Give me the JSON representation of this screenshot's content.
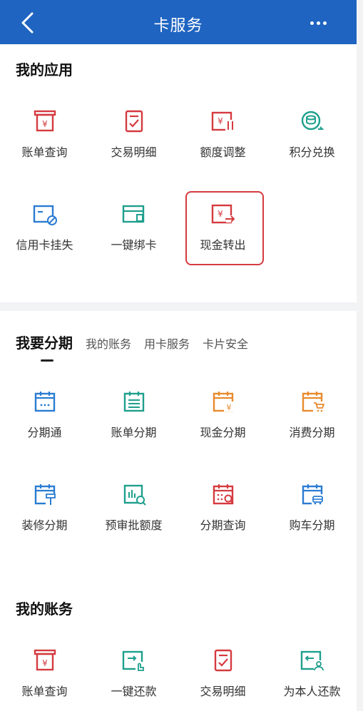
{
  "header": {
    "title": "卡服务",
    "back_icon": "chevron-left-icon",
    "more_icon": "more-dots-icon"
  },
  "colors": {
    "primary": "#1f64c1",
    "red": "#d53a3f",
    "blue": "#2a7cd2",
    "teal": "#1f9f8d",
    "orange": "#e98a2e"
  },
  "my_apps": {
    "title": "我的应用",
    "items": [
      {
        "label": "账单查询",
        "icon": "bill-icon"
      },
      {
        "label": "交易明细",
        "icon": "transaction-detail-icon"
      },
      {
        "label": "额度调整",
        "icon": "limit-adjust-icon"
      },
      {
        "label": "积分兑换",
        "icon": "points-exchange-icon"
      },
      {
        "label": "信用卡挂失",
        "icon": "card-report-loss-icon"
      },
      {
        "label": "一键绑卡",
        "icon": "bind-card-icon"
      },
      {
        "label": "现金转出",
        "icon": "cash-transfer-icon"
      }
    ]
  },
  "tabs": [
    {
      "label": "我要分期"
    },
    {
      "label": "我的账务"
    },
    {
      "label": "用卡服务"
    },
    {
      "label": "卡片安全"
    }
  ],
  "installments": {
    "items": [
      {
        "label": "分期通",
        "icon": "calendar-icon"
      },
      {
        "label": "账单分期",
        "icon": "bill-installment-icon"
      },
      {
        "label": "现金分期",
        "icon": "cash-installment-icon"
      },
      {
        "label": "消费分期",
        "icon": "shopping-installment-icon"
      },
      {
        "label": "装修分期",
        "icon": "decoration-installment-icon"
      },
      {
        "label": "预审批额度",
        "icon": "preapproval-icon"
      },
      {
        "label": "分期查询",
        "icon": "installment-query-icon"
      },
      {
        "label": "购车分期",
        "icon": "car-installment-icon"
      }
    ]
  },
  "my_accounts": {
    "title": "我的账务",
    "items": [
      {
        "label": "账单查询",
        "icon": "bill-icon"
      },
      {
        "label": "一键还款",
        "icon": "one-click-repay-icon"
      },
      {
        "label": "交易明细",
        "icon": "transaction-detail-icon"
      },
      {
        "label": "为本人还款",
        "icon": "repay-self-icon"
      }
    ]
  }
}
